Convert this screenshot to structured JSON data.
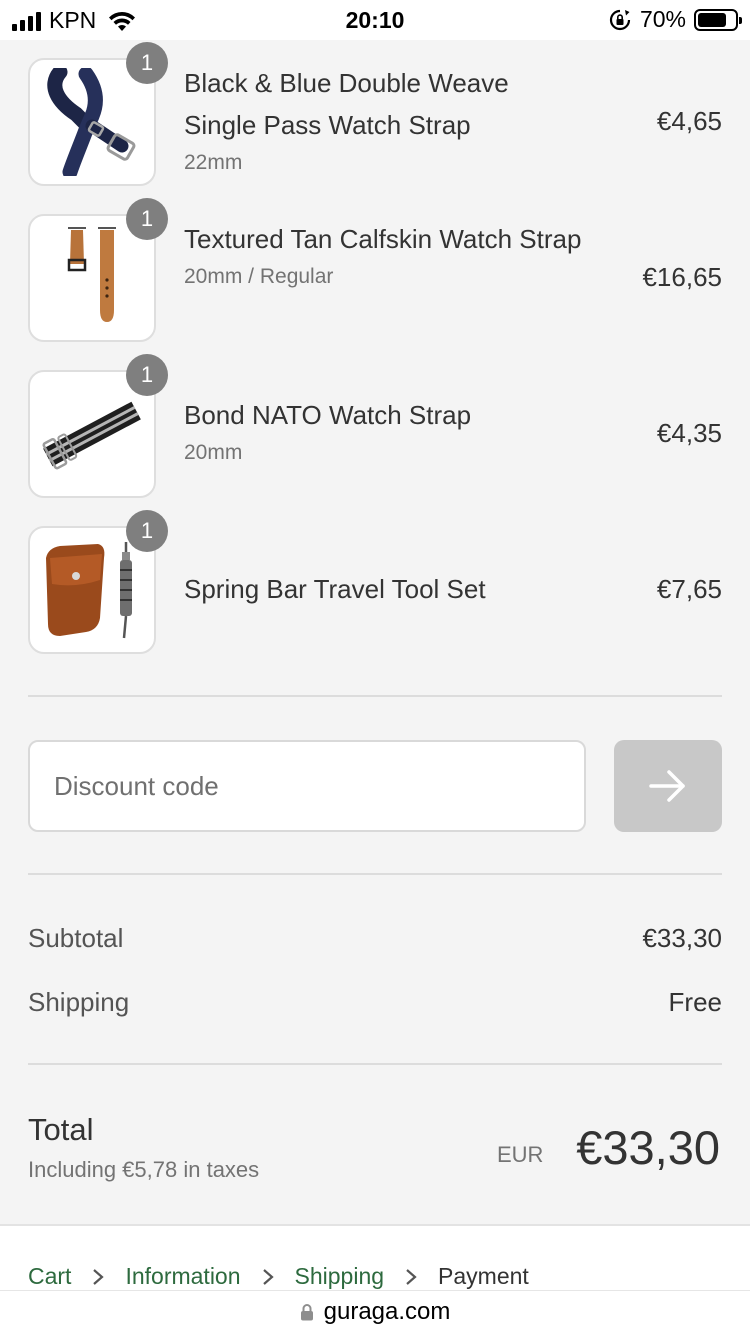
{
  "status_bar": {
    "carrier": "KPN",
    "time": "20:10",
    "battery": "70%",
    "battery_level": 0.7
  },
  "products": [
    {
      "quantity": "1",
      "name": "Black & Blue Double Weave Single Pass Watch Strap",
      "variant": "22mm",
      "price": "€4,65",
      "image": "nato-strap-navy"
    },
    {
      "quantity": "1",
      "name": "Textured Tan Calfskin Watch Strap",
      "variant": "20mm / Regular",
      "price": "€16,65",
      "image": "leather-strap-tan"
    },
    {
      "quantity": "1",
      "name": "Bond NATO Watch Strap",
      "variant": "20mm",
      "price": "€4,35",
      "image": "nato-strap-striped"
    },
    {
      "quantity": "1",
      "name": "Spring Bar Travel Tool Set",
      "variant": "",
      "price": "€7,65",
      "image": "tool-pouch"
    }
  ],
  "discount": {
    "placeholder": "Discount code",
    "value": "",
    "button_icon": "arrow-right-icon"
  },
  "summary": {
    "subtotal_label": "Subtotal",
    "subtotal_value": "€33,30",
    "shipping_label": "Shipping",
    "shipping_value": "Free"
  },
  "total": {
    "label": "Total",
    "tax_note": "Including €5,78 in taxes",
    "currency": "EUR",
    "value": "€33,30"
  },
  "breadcrumb": {
    "items": [
      "Cart",
      "Information",
      "Shipping",
      "Payment"
    ],
    "current": "Payment"
  },
  "browser": {
    "url": "guraga.com"
  },
  "colors": {
    "background": "#f4f4f4",
    "link": "#2d6a3e",
    "badge": "#7f7f7f",
    "button_disabled": "#c8c8c8"
  }
}
